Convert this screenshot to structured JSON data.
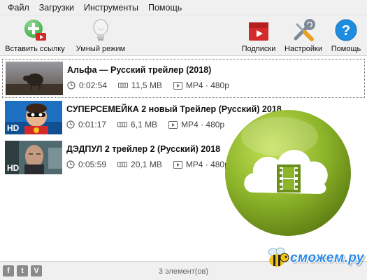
{
  "menu": [
    "Файл",
    "Загрузки",
    "Инструменты",
    "Помощь"
  ],
  "toolbar": {
    "paste_label": "Вставить ссылку",
    "smart_label": "Умный режим",
    "subs_label": "Подписки",
    "settings_label": "Настройки",
    "help_label": "Помощь"
  },
  "items": [
    {
      "title": "Альфа — Русский трейлер (2018)",
      "duration": "0:02:54",
      "size": "11,5 MB",
      "format": "MP4 · 480p"
    },
    {
      "title": "СУПЕРСЕМЕЙКА 2 новый Трейлер (Русский) 2018",
      "duration": "0:01:17",
      "size": "6,1 MB",
      "format": "MP4 · 480p"
    },
    {
      "title": "ДЭДПУЛ 2 трейлер 2 (Русский) 2018",
      "duration": "0:05:59",
      "size": "20,1 MB",
      "format": "MP4 · 480p"
    }
  ],
  "hd_badge": "HD",
  "status": {
    "count_text": "3 элемент(ов)"
  },
  "social": [
    "f",
    "t",
    "V"
  ],
  "watermark": "сможем.ру",
  "colors": {
    "accent_green": "#8db52a",
    "toolbar_bg": "#f0f0f0",
    "help_blue": "#1e8de0",
    "subs_red": "#d42a2a"
  }
}
